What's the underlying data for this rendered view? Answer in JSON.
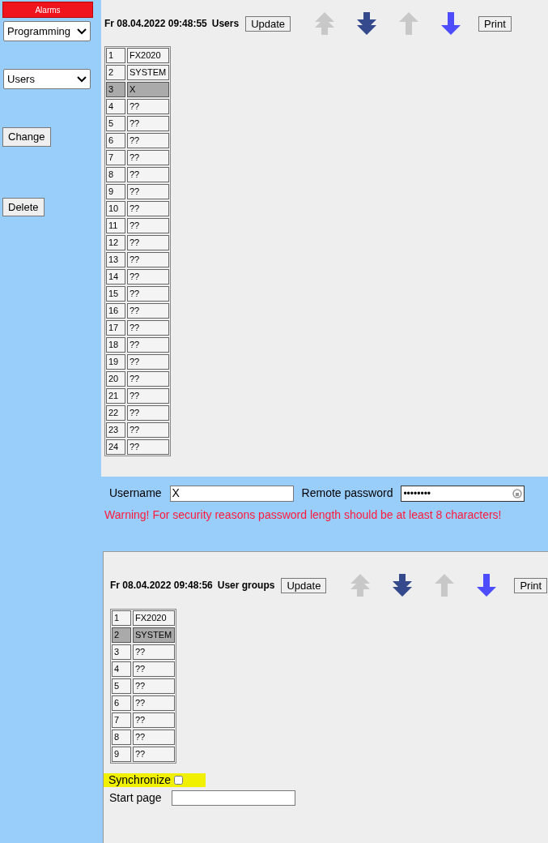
{
  "sidebar": {
    "alarms_button": "Alarms",
    "selects": [
      {
        "value": "Programming"
      },
      {
        "value": "Users"
      }
    ],
    "buttons": [
      "Change",
      "Delete"
    ]
  },
  "users_panel": {
    "timestamp": "Fr 08.04.2022 09:48:55",
    "title": "Users",
    "update_button": "Update",
    "print_button": "Print",
    "nav_buttons": [
      {
        "kind": "double_up",
        "disabled": true
      },
      {
        "kind": "double_down",
        "disabled": false
      },
      {
        "kind": "up",
        "disabled": true
      },
      {
        "kind": "down",
        "disabled": false
      }
    ],
    "rows": [
      {
        "number": "1",
        "name": "FX2020",
        "selected": false
      },
      {
        "number": "2",
        "name": "SYSTEM",
        "selected": false
      },
      {
        "number": "3",
        "name": "X",
        "selected": true
      },
      {
        "number": "4",
        "name": "??",
        "selected": false
      },
      {
        "number": "5",
        "name": "??",
        "selected": false
      },
      {
        "number": "6",
        "name": "??",
        "selected": false
      },
      {
        "number": "7",
        "name": "??",
        "selected": false
      },
      {
        "number": "8",
        "name": "??",
        "selected": false
      },
      {
        "number": "9",
        "name": "??",
        "selected": false
      },
      {
        "number": "10",
        "name": "??",
        "selected": false
      },
      {
        "number": "11",
        "name": "??",
        "selected": false
      },
      {
        "number": "12",
        "name": "??",
        "selected": false
      },
      {
        "number": "13",
        "name": "??",
        "selected": false
      },
      {
        "number": "14",
        "name": "??",
        "selected": false
      },
      {
        "number": "15",
        "name": "??",
        "selected": false
      },
      {
        "number": "16",
        "name": "??",
        "selected": false
      },
      {
        "number": "17",
        "name": "??",
        "selected": false
      },
      {
        "number": "18",
        "name": "??",
        "selected": false
      },
      {
        "number": "19",
        "name": "??",
        "selected": false
      },
      {
        "number": "20",
        "name": "??",
        "selected": false
      },
      {
        "number": "21",
        "name": "??",
        "selected": false
      },
      {
        "number": "22",
        "name": "??",
        "selected": false
      },
      {
        "number": "23",
        "name": "??",
        "selected": false
      },
      {
        "number": "24",
        "name": "??",
        "selected": false
      }
    ]
  },
  "user_form": {
    "username_label": "Username",
    "username_value": "X",
    "password_label": "Remote password",
    "password_value": "••••••••",
    "warning": "Warning! For security reasons password length should be at least 8 characters!"
  },
  "groups_panel": {
    "timestamp": "Fr 08.04.2022 09:48:56",
    "title": "User groups",
    "update_button": "Update",
    "print_button": "Print",
    "nav_buttons": [
      {
        "kind": "double_up",
        "disabled": true
      },
      {
        "kind": "double_down",
        "disabled": false
      },
      {
        "kind": "up",
        "disabled": true
      },
      {
        "kind": "down",
        "disabled": false
      }
    ],
    "rows": [
      {
        "number": "1",
        "name": "FX2020",
        "selected": false
      },
      {
        "number": "2",
        "name": "SYSTEM",
        "selected": true
      },
      {
        "number": "3",
        "name": "??",
        "selected": false
      },
      {
        "number": "4",
        "name": "??",
        "selected": false
      },
      {
        "number": "5",
        "name": "??",
        "selected": false
      },
      {
        "number": "6",
        "name": "??",
        "selected": false
      },
      {
        "number": "7",
        "name": "??",
        "selected": false
      },
      {
        "number": "8",
        "name": "??",
        "selected": false
      },
      {
        "number": "9",
        "name": "??",
        "selected": false
      }
    ],
    "synchronize": {
      "label": "Synchronize",
      "checked": false
    },
    "start_page": {
      "label": "Start page"
    }
  }
}
